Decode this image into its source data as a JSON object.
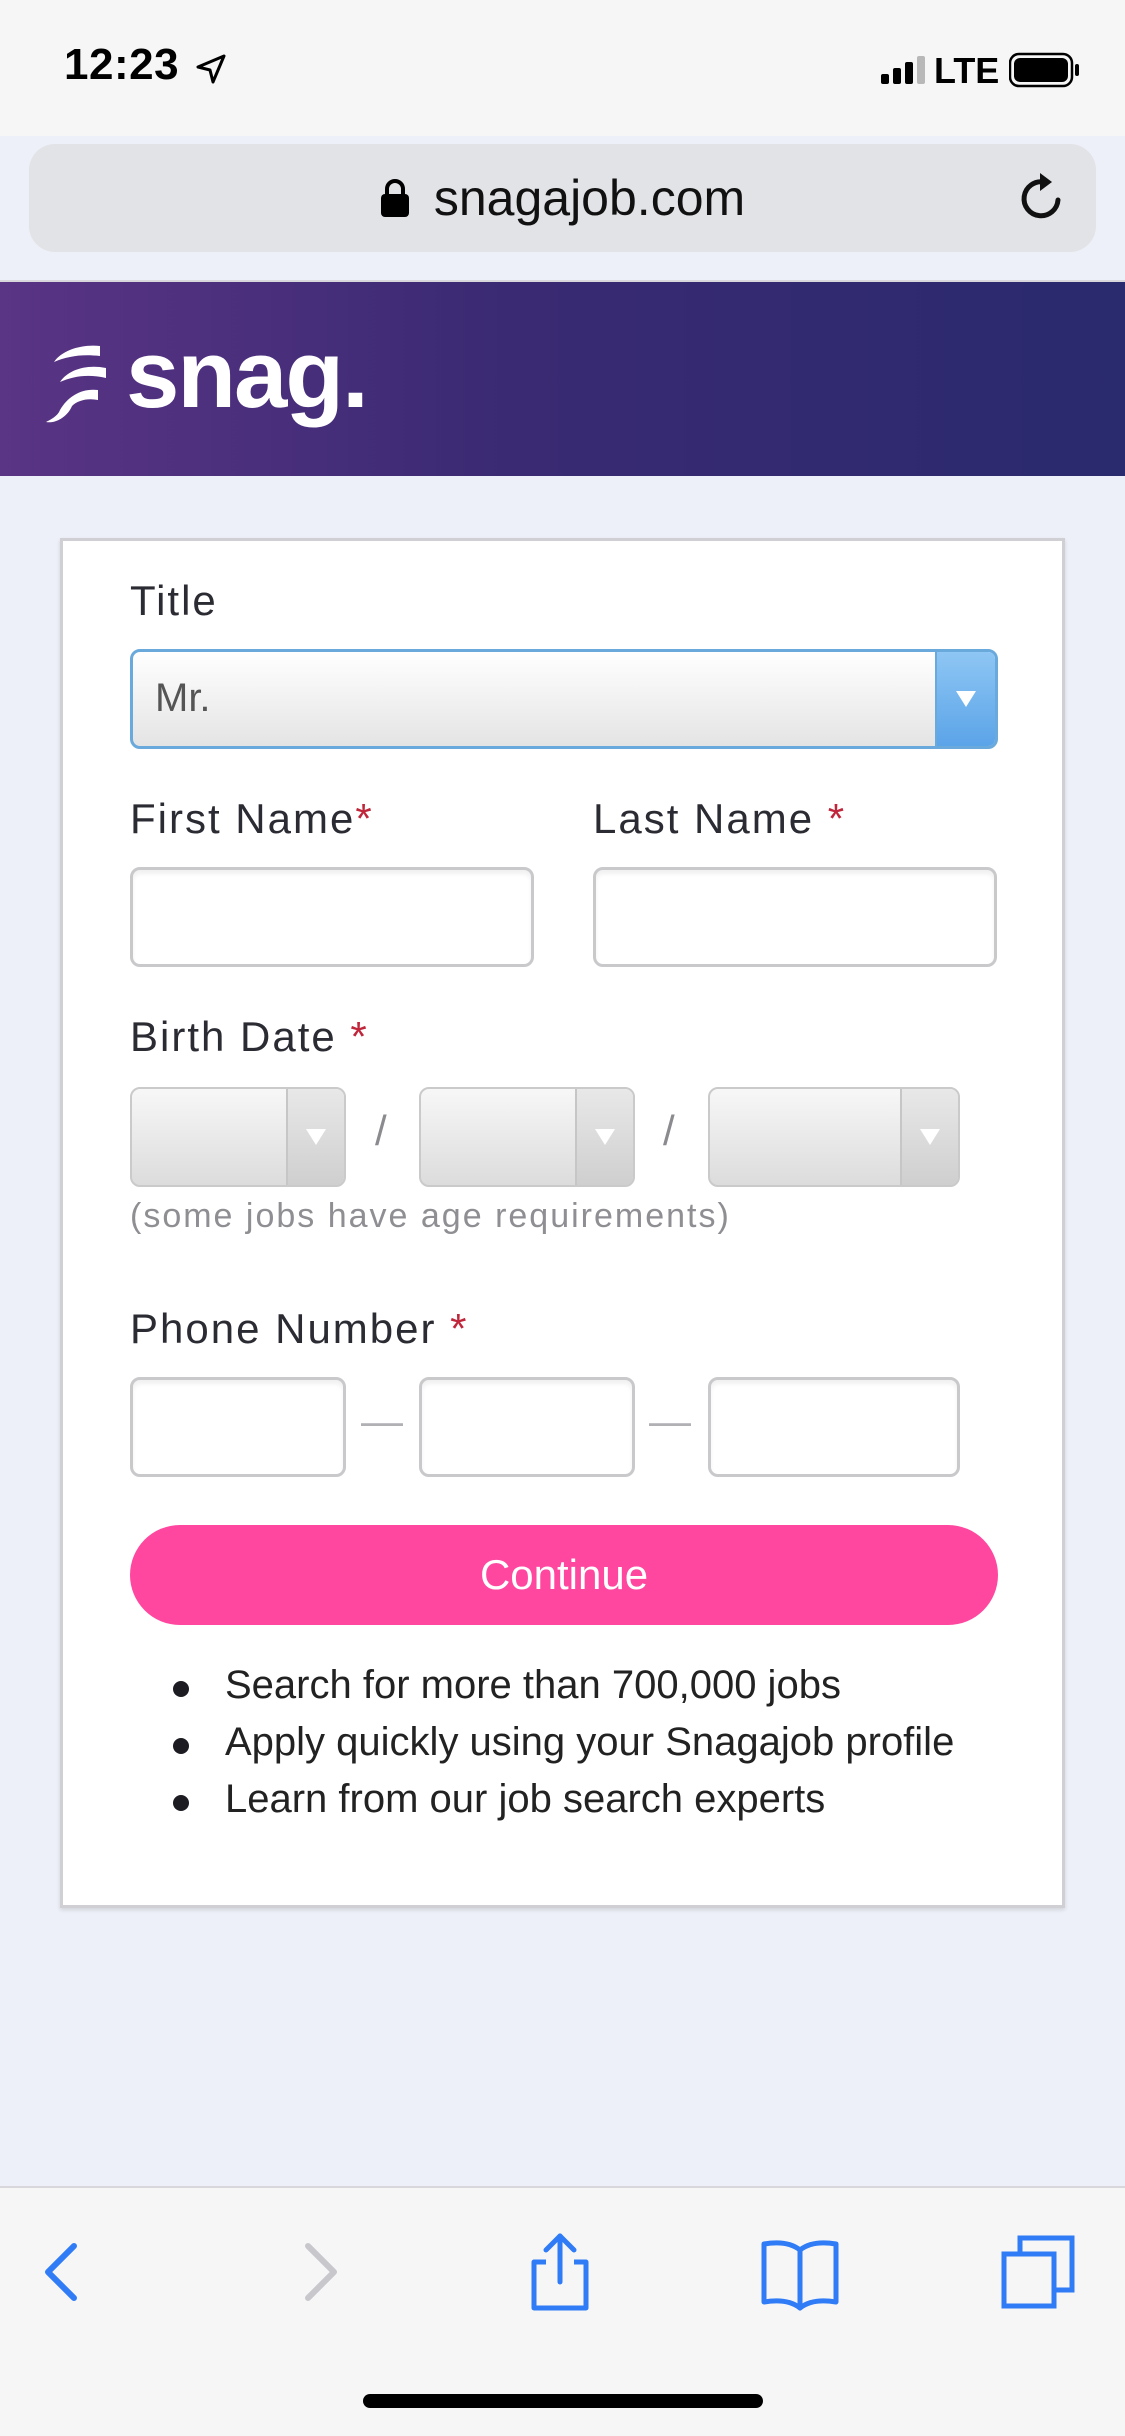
{
  "status_bar": {
    "time": "12:23",
    "network": "LTE"
  },
  "browser": {
    "url": "snagajob.com"
  },
  "brand": {
    "name": "snag."
  },
  "form": {
    "title_label": "Title",
    "title_value": "Mr.",
    "first_name_label": "First Name",
    "last_name_label": "Last Name",
    "required_mark": "*",
    "birth_date_label": "Birth Date",
    "date_separator": "/",
    "birth_date_hint": "(some jobs have age requirements)",
    "phone_label": "Phone Number",
    "phone_separator": "—",
    "continue_label": "Continue",
    "accent_color": "#ff47a0"
  },
  "features": [
    "Search for more than 700,000 jobs",
    "Apply quickly using your Snagajob profile",
    "Learn from our job search experts"
  ],
  "toolbar": {
    "icons": [
      "back-icon",
      "forward-icon",
      "share-icon",
      "bookmarks-icon",
      "tabs-icon"
    ]
  }
}
